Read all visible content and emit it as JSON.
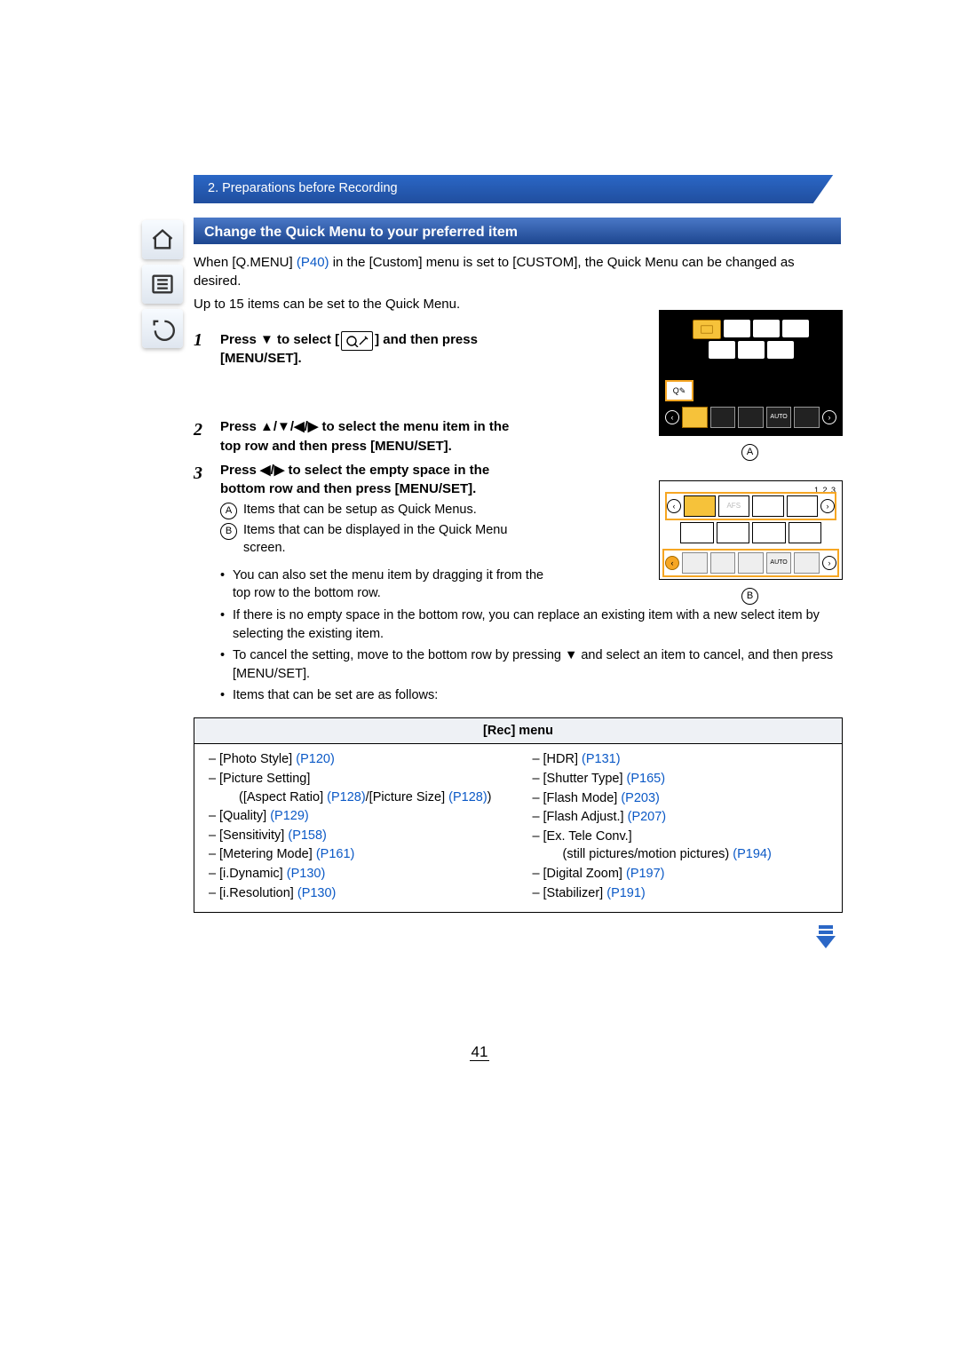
{
  "breadcrumb": "2. Preparations before Recording",
  "section_title": "Change the Quick Menu to your preferred item",
  "intro": {
    "p1a": "When [Q.MENU] ",
    "p1_link": "(P40)",
    "p1b": " in the [Custom] menu is set to [CUSTOM], the Quick Menu can be changed as desired.",
    "p2": "Up to 15 items can be set to the Quick Menu."
  },
  "qmenu_icon_label": "Q✎",
  "steps": [
    {
      "num": "1",
      "title_a": "Press ▼ to select [",
      "title_b": "] and then press [MENU/SET]."
    },
    {
      "num": "2",
      "title": "Press ▲/▼/◀/▶ to select the menu item in the top row and then press [MENU/SET]."
    },
    {
      "num": "3",
      "title": "Press ◀/▶ to select the empty space in the bottom row and then press [MENU/SET]."
    }
  ],
  "annotations": {
    "A": "Items that can be setup as Quick Menus.",
    "B": "Items that can be displayed in the Quick Menu screen."
  },
  "bullets": [
    "You can also set the menu item by dragging it from the top row to the bottom row.",
    "If there is no empty space in the bottom row, you can replace an existing item with a new select item by selecting the existing item.",
    "To cancel the setting, move to the bottom row by pressing ▼ and select an item to cancel, and then press [MENU/SET].",
    "Items that can be set are as follows:"
  ],
  "illus": {
    "label_A": "A",
    "label_B": "B",
    "page123": "1 2 3",
    "row2_afs": "AFS"
  },
  "rec_menu": {
    "title": "[Rec] menu",
    "left": [
      {
        "t": "[Photo Style] ",
        "l": "(P120)"
      },
      {
        "t": "[Picture Setting]",
        "l": ""
      },
      {
        "sub": true,
        "t": "([Aspect Ratio] ",
        "l": "(P128)",
        "t2": "/[Picture Size] ",
        "l2": "(P128)",
        "t3": ")"
      },
      {
        "t": "[Quality] ",
        "l": "(P129)"
      },
      {
        "t": "[Sensitivity] ",
        "l": "(P158)"
      },
      {
        "t": "[Metering Mode] ",
        "l": "(P161)"
      },
      {
        "t": "[i.Dynamic] ",
        "l": "(P130)"
      },
      {
        "t": "[i.Resolution] ",
        "l": "(P130)"
      }
    ],
    "right": [
      {
        "t": "[HDR] ",
        "l": "(P131)"
      },
      {
        "t": "[Shutter Type] ",
        "l": "(P165)"
      },
      {
        "t": "[Flash Mode] ",
        "l": "(P203)"
      },
      {
        "t": "[Flash Adjust.] ",
        "l": "(P207)"
      },
      {
        "t": "[Ex. Tele Conv.]",
        "l": ""
      },
      {
        "sub": true,
        "t": "(still pictures/motion pictures) ",
        "l": "(P194)"
      },
      {
        "t": "[Digital Zoom] ",
        "l": "(P197)"
      },
      {
        "t": "[Stabilizer] ",
        "l": "(P191)"
      }
    ]
  },
  "page_number": "41",
  "nav_icons": [
    "home-icon",
    "toc-icon",
    "back-icon"
  ]
}
